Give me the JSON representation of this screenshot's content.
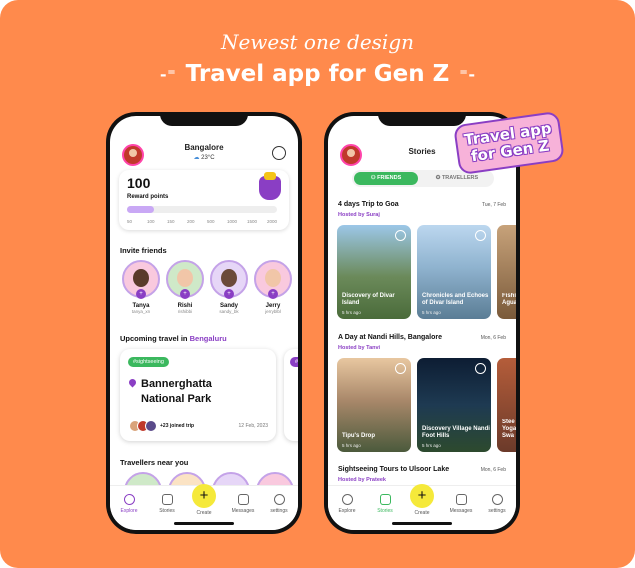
{
  "headline": {
    "line1": "Newest one design",
    "line2": "Travel app for Gen Z"
  },
  "sticker": {
    "line1": "Travel app",
    "line2": "for Gen Z"
  },
  "colors": {
    "background": "#FF8A4C",
    "accent": "#8a3ec4",
    "green": "#3bb85e",
    "create": "#F5E93A"
  },
  "phone1": {
    "location": "Bangalore",
    "weather": "23°C",
    "reward": {
      "points": "100",
      "label": "Reward points",
      "progress_fraction": 0.18,
      "milestones": [
        "50",
        "100",
        "150",
        "200",
        "500",
        "1000",
        "1500",
        "2000"
      ]
    },
    "invite_title": "Invite friends",
    "friends": [
      {
        "name": "Tanya",
        "handle": "tanya_xn"
      },
      {
        "name": "Rishi",
        "handle": "rishibbi"
      },
      {
        "name": "Sandy",
        "handle": "sandy_bk"
      },
      {
        "name": "Jerry",
        "handle": "jerryblbl"
      }
    ],
    "upcoming_label": "Upcoming travel in",
    "upcoming_city": "Bengaluru",
    "trip": {
      "tag": "#sightseeing",
      "title_line1": "Bannerghatta",
      "title_line2": "National Park",
      "joined": "+23 joined trip",
      "date": "12 Feb, 2023"
    },
    "near_title": "Travellers near you"
  },
  "phone2": {
    "title": "Stories",
    "tab_friends": "FRIENDS",
    "tab_travellers": "TRAVELLERS",
    "stories": [
      {
        "title": "4 days Trip to Goa",
        "by": "Hosted by Suraj",
        "date": "Tue, 7 Feb",
        "photos": [
          {
            "caption": "Discovery of Divar Island",
            "ago": "5 hrs ago"
          },
          {
            "caption": "Chronicles and Echoes of Divar Island",
            "ago": "5 hrs ago"
          },
          {
            "caption": "Fishi Agua",
            "ago": ""
          }
        ]
      },
      {
        "title": "A Day at Nandi Hills, Bangalore",
        "by": "Hosted by Tanvi",
        "date": "Mon, 6 Feb",
        "photos": [
          {
            "caption": "Tipu's Drop",
            "ago": "5 hrs ago"
          },
          {
            "caption": "Discovery Village Nandi Foot Hills",
            "ago": "5 hrs ago"
          },
          {
            "caption": "Stee Yoga Swa",
            "ago": ""
          }
        ]
      },
      {
        "title": "Sightseeing Tours to Ulsoor Lake",
        "by": "Hosted by Prateek",
        "date": "Mon, 6 Feb"
      }
    ]
  },
  "nav": {
    "explore": "Explore",
    "stories": "Stories",
    "create": "Create",
    "messages": "Messages",
    "settings": "settings",
    "plus": "+"
  }
}
